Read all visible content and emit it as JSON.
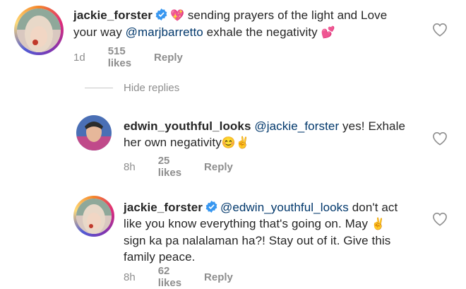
{
  "comments": [
    {
      "username": "jackie_forster",
      "verified": true,
      "emoji_lead": "💖",
      "text_1": " sending prayers of the light and Love",
      "text_2": "your way ",
      "mention": "@marjbarretto",
      "text_3": " exhale the  negativity ",
      "emoji_tail": "💕",
      "time": "1d",
      "likes": "515 likes",
      "reply": "Reply"
    },
    {
      "username": "edwin_youthful_looks",
      "verified": false,
      "mention": "@jackie_forster",
      "text_1": " yes! Exhale",
      "text_2": "her own negativity",
      "emoji_tail": "😊✌",
      "time": "8h",
      "likes": "25 likes",
      "reply": "Reply"
    },
    {
      "username": "jackie_forster",
      "verified": true,
      "mention": "@edwin_youthful_looks",
      "text_1": " don't act",
      "text_2": "like you know everything that's going on. May ",
      "emoji_mid": "✌",
      "text_3": "sign ka pa nalalaman ha?! Stay out of it. Give this",
      "text_4": "family peace.",
      "time": "8h",
      "likes": "62 likes",
      "reply": "Reply"
    }
  ],
  "hide_replies": "Hide replies",
  "colors": {
    "verified": "#3897f0",
    "mention": "#00376b",
    "meta": "#8e8e8e"
  },
  "icons": [
    "verified-badge-icon",
    "heart-icon"
  ]
}
